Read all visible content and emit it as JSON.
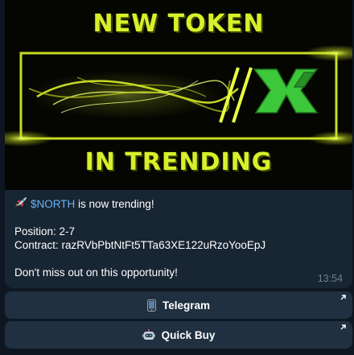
{
  "banner": {
    "top_text": "NEW TOKEN",
    "bottom_text": "IN TRENDING",
    "accent_color": "#d8f02a",
    "logo_color": "#3cc83a"
  },
  "message": {
    "ticker": "$NORTH",
    "trending_text": " is now trending!",
    "position_line": "Position: 2-7",
    "contract_line": "Contract: razRVbPbtNtFt5TTa63XE122uRzoYooEpJ",
    "cta_line": "Don't miss out on this opportunity!",
    "time": "13:54",
    "icon": "rocket-icon"
  },
  "buttons": [
    {
      "label": "Telegram",
      "icon": "phone-icon"
    },
    {
      "label": "Quick Buy",
      "icon": "robot-icon"
    }
  ],
  "colors": {
    "background": "#0e1621",
    "bubble": "#182533",
    "button": "#203040",
    "link": "#6ab3f3",
    "time": "#6d7f8f"
  }
}
